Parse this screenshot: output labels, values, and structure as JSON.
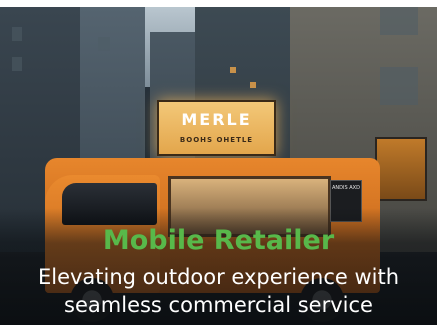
{
  "signage": {
    "truck_sign": "MERLЕ",
    "truck_sign_sub": "BOOHS OHETLE",
    "menu_board": "ANDIS AXD"
  },
  "caption": {
    "title": "Mobile Retailer",
    "subtitle_line1": "Elevating outdoor experience with",
    "subtitle_line2": "seamless commercial service"
  },
  "colors": {
    "title": "#58b84a",
    "subtitle": "#ffffff",
    "truck": "#e7862c"
  }
}
